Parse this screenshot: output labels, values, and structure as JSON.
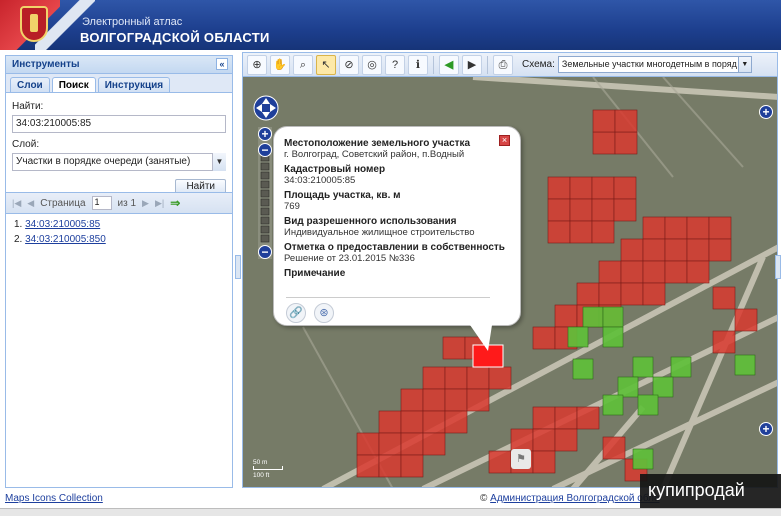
{
  "header": {
    "subtitle": "Электронный атлас",
    "title": "ВОЛГОГРАДСКОЙ ОБЛАСТИ"
  },
  "left_panel": {
    "title": "Инструменты",
    "collapse_icon": "«",
    "tabs": [
      "Слои",
      "Поиск",
      "Инструкция"
    ],
    "active_tab": "Поиск",
    "find_label": "Найти:",
    "find_value": "34:03:210005:85",
    "layer_label": "Слой:",
    "layer_value": "Участки в порядке очереди (занятые)",
    "find_button": "Найти",
    "pager": {
      "page_label": "Страница",
      "page_value": "1",
      "of_label": "из 1"
    },
    "results": [
      {
        "index": "1.",
        "label": "34:03:210005:85"
      },
      {
        "index": "2.",
        "label": "34:03:210005:850"
      }
    ]
  },
  "toolbar": {
    "icons": [
      "zoom-extent-icon",
      "pan-hand-icon",
      "zoom-box-icon",
      "select-identify-icon",
      "clear-selection-icon",
      "measure-icon",
      "help-icon",
      "identify-info-icon",
      "back-arrow-icon",
      "forward-arrow-icon",
      "print-icon"
    ],
    "scheme_label": "Схема:",
    "scheme_value": "Земельные участки многодетным в поряд"
  },
  "popup": {
    "fields": [
      {
        "label": "Местоположение земельного участка",
        "value": "г. Волгоград, Советский район, п.Водный"
      },
      {
        "label": "Кадастровый номер",
        "value": "34:03:210005:85"
      },
      {
        "label": "Площадь участка, кв. м",
        "value": "769"
      },
      {
        "label": "Вид разрешенного использования",
        "value": "Индивидуальное жилищное строительство"
      },
      {
        "label": "Отметка о предоставлении в собственность",
        "value": "Решение от 23.01.2015 №336"
      },
      {
        "label": "Примечание",
        "value": ""
      }
    ]
  },
  "scalebar": {
    "top": "50 m",
    "bottom": "100 ft"
  },
  "footer": {
    "left_link": "Maps Icons Collection",
    "right_prefix": "©",
    "right_link": "Администрация Волгоградской обла",
    "watermark": "купипродай"
  },
  "colors": {
    "occupied_plot": "#d93a2f",
    "free_plot": "#5fbf3a",
    "selected_plot": "#ff1a1a",
    "header_blue": "#1d3f8e"
  }
}
